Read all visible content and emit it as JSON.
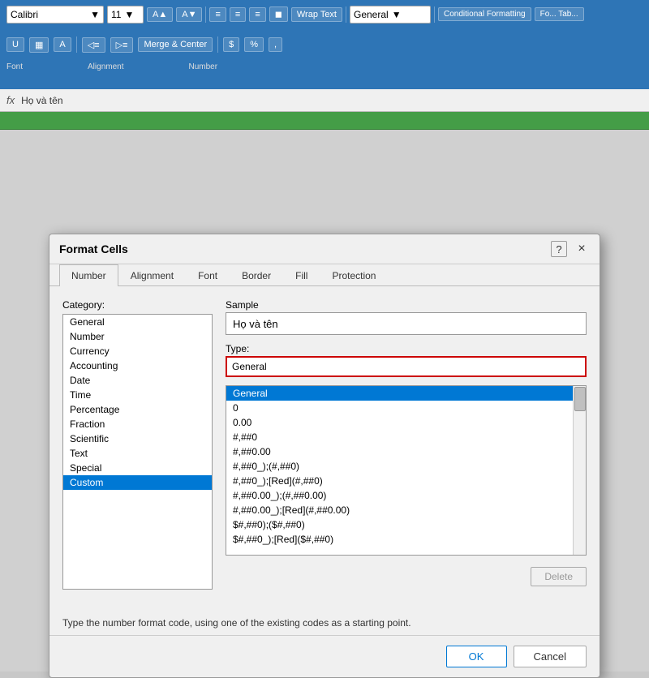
{
  "toolbar": {
    "font_size": "11",
    "font_name": "General",
    "wrap_text": "Wrap Text",
    "merge_center": "Merge & Center",
    "format_section": "Font",
    "alignment_section": "Alignment",
    "number_section": "Number",
    "conditional_label": "Conditional Formatting",
    "format_table_label": "Fo... Tab..."
  },
  "formula_bar": {
    "fx_label": "fx",
    "cell_ref": "Họ và tên"
  },
  "dialog": {
    "title": "Format Cells",
    "help_label": "?",
    "close_label": "×",
    "tabs": [
      {
        "label": "Number",
        "active": true
      },
      {
        "label": "Alignment",
        "active": false
      },
      {
        "label": "Font",
        "active": false
      },
      {
        "label": "Border",
        "active": false
      },
      {
        "label": "Fill",
        "active": false
      },
      {
        "label": "Protection",
        "active": false
      }
    ],
    "category": {
      "label": "Category:",
      "items": [
        "General",
        "Number",
        "Currency",
        "Accounting",
        "Date",
        "Time",
        "Percentage",
        "Fraction",
        "Scientific",
        "Text",
        "Special",
        "Custom"
      ],
      "selected": "Custom"
    },
    "sample": {
      "label": "Sample",
      "value": "Họ và tên"
    },
    "type": {
      "label": "Type:",
      "input_value": "General",
      "list_items": [
        "General",
        "0",
        "0.00",
        "#,##0",
        "#,##0.00",
        "#,##0_);(#,##0)",
        "#,##0_);[Red](#,##0)",
        "#,##0.00_);(#,##0.00)",
        "#,##0.00_);[Red](#,##0.00)",
        "$#,##0);($#,##0)",
        "$#,##0_);[Red]($#,##0)"
      ],
      "selected": "General"
    },
    "delete_button": "Delete",
    "description": "Type the number format code, using one of the existing codes as a starting point.",
    "ok_button": "OK",
    "cancel_button": "Cancel"
  }
}
